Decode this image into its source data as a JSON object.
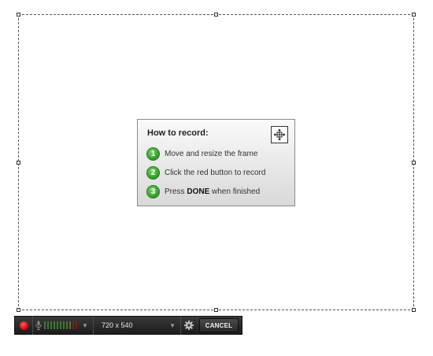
{
  "instructions": {
    "title": "How to record:",
    "steps": [
      {
        "num": "1",
        "text": "Move and resize the frame"
      },
      {
        "num": "2",
        "text": "Click the red button to record"
      },
      {
        "num": "3",
        "prefix": "Press ",
        "bold": "DONE",
        "suffix": " when finished"
      }
    ]
  },
  "toolbar": {
    "resolution": "720 x 540",
    "cancel_label": "CANCEL"
  },
  "icons": {
    "record": "record-icon",
    "microphone": "microphone-icon",
    "dropdown": "chevron-down-icon",
    "settings": "gear-icon",
    "move": "move-icon"
  },
  "colors": {
    "record": "#d80000",
    "step_badge": "#3aa52f",
    "toolbar_bg": "#262626",
    "meter_green": "#3c7a2e",
    "meter_red": "#7a2020"
  }
}
